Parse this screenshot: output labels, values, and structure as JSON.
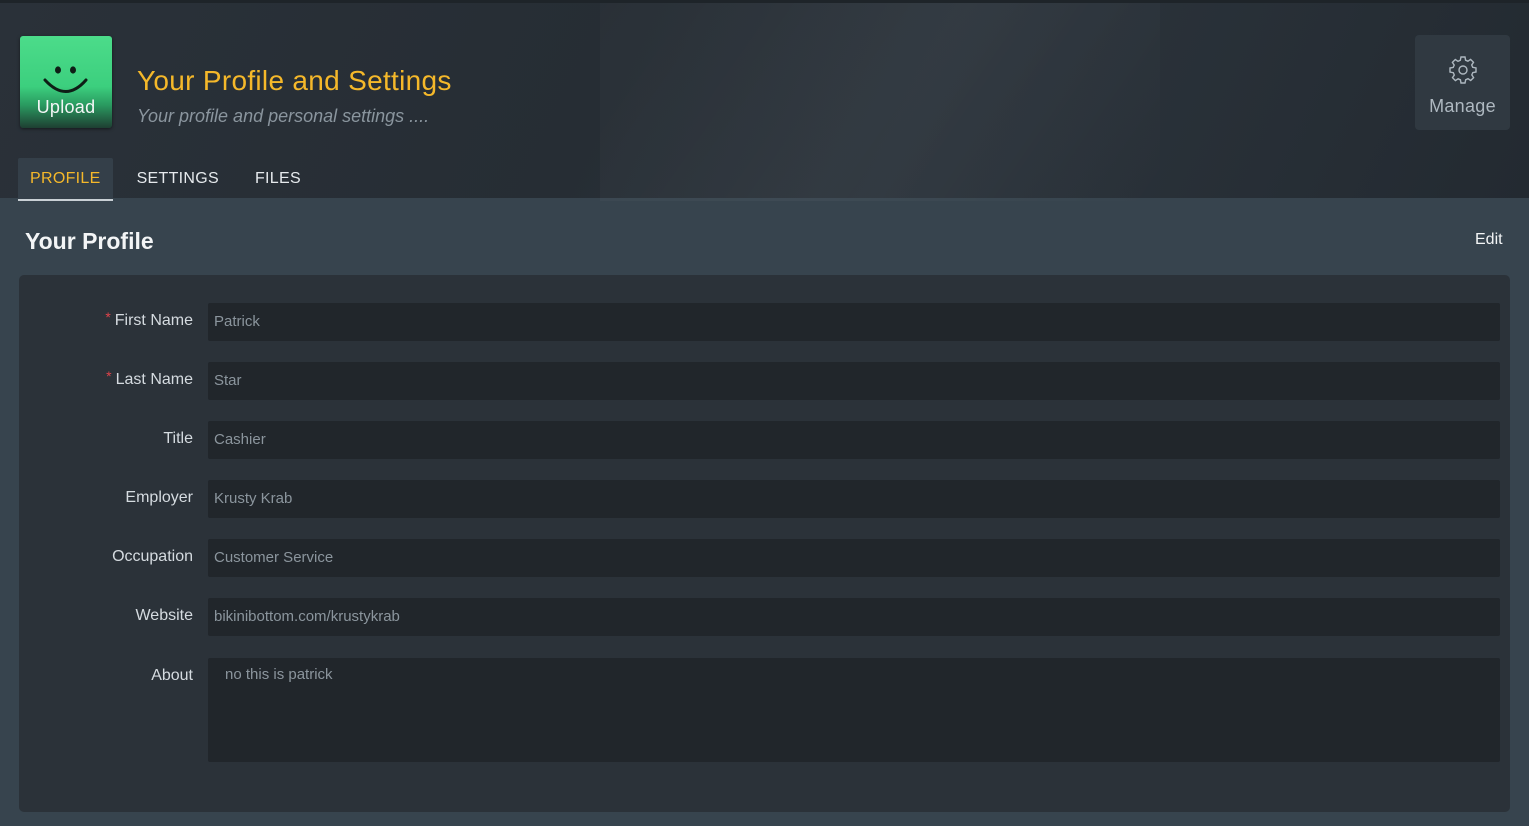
{
  "header": {
    "avatar": {
      "upload_label": "Upload",
      "icon": "smiley-face-icon",
      "color": "#3ccf7e"
    },
    "title": "Your Profile and Settings",
    "subtitle": "Your profile and personal settings ....",
    "manage": {
      "label": "Manage",
      "icon": "gear-icon"
    }
  },
  "tabs": [
    {
      "label": "PROFILE",
      "active": true
    },
    {
      "label": "SETTINGS",
      "active": false
    },
    {
      "label": "FILES",
      "active": false
    }
  ],
  "section": {
    "title": "Your Profile",
    "edit_label": "Edit"
  },
  "form": {
    "required_marker": "*",
    "fields": [
      {
        "label": "First Name",
        "value": "Patrick",
        "required": true
      },
      {
        "label": "Last Name",
        "value": "Star",
        "required": true
      },
      {
        "label": "Title",
        "value": "Cashier",
        "required": false
      },
      {
        "label": "Employer",
        "value": "Krusty Krab",
        "required": false
      },
      {
        "label": "Occupation",
        "value": "Customer Service",
        "required": false
      },
      {
        "label": "Website",
        "value": "bikinibottom.com/krustykrab",
        "required": false
      }
    ],
    "about": {
      "label": "About",
      "value": "no this is patrick"
    }
  },
  "colors": {
    "accent": "#f5b82a",
    "required": "#e0434a",
    "background": "#37444e",
    "card": "#2b3239",
    "input": "#21262b"
  }
}
